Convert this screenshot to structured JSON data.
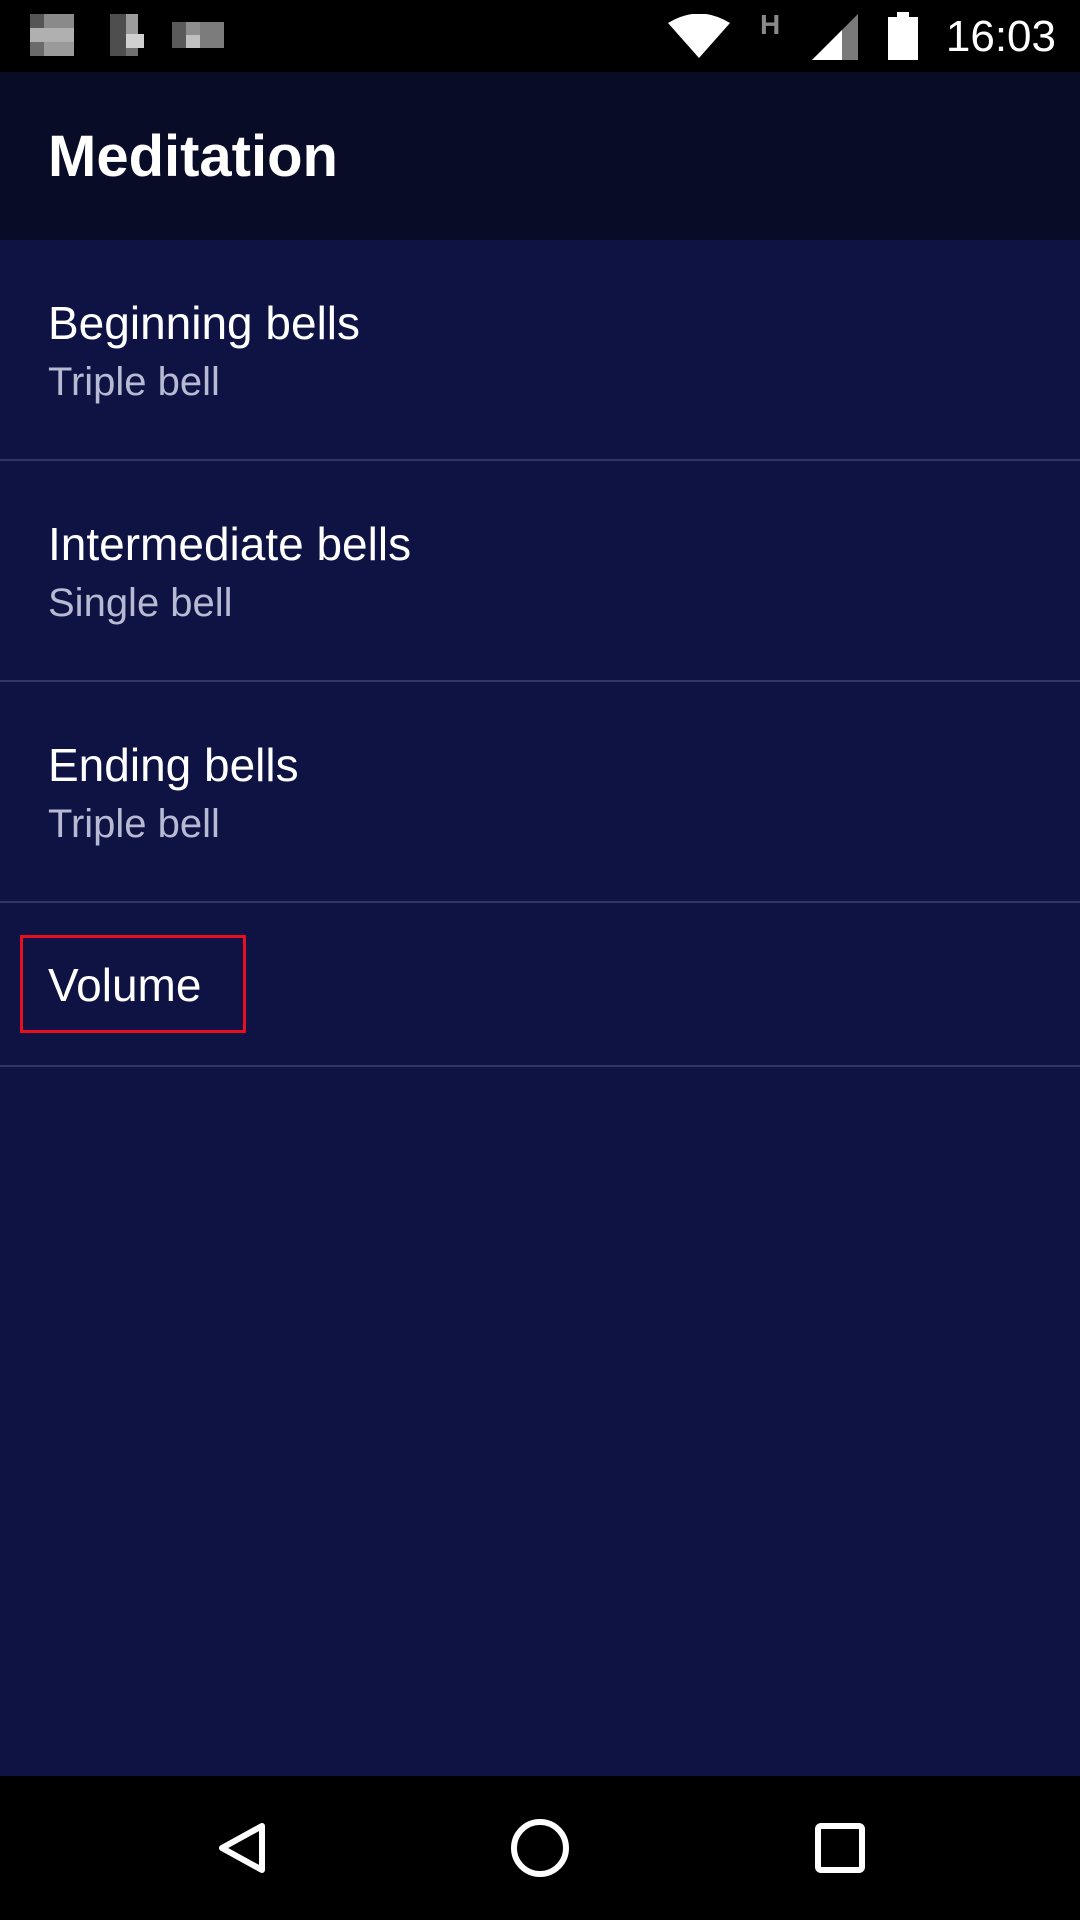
{
  "status_bar": {
    "time": "16:03",
    "network_type": "H",
    "icons": [
      "notification-icon",
      "notification-icon",
      "notification-icon",
      "wifi-icon",
      "signal-icon",
      "battery-icon"
    ]
  },
  "app_bar": {
    "title": "Meditation"
  },
  "preferences": [
    {
      "title": "Beginning bells",
      "summary": "Triple bell"
    },
    {
      "title": "Intermediate bells",
      "summary": "Single bell"
    },
    {
      "title": "Ending bells",
      "summary": "Triple bell"
    },
    {
      "title": "Volume"
    }
  ],
  "nav_bar": {
    "icons": [
      "back-icon",
      "home-icon",
      "recent-apps-icon"
    ]
  },
  "colors": {
    "background": "#0e1343",
    "app_bar": "#080c26",
    "highlight": "#e8101e"
  }
}
